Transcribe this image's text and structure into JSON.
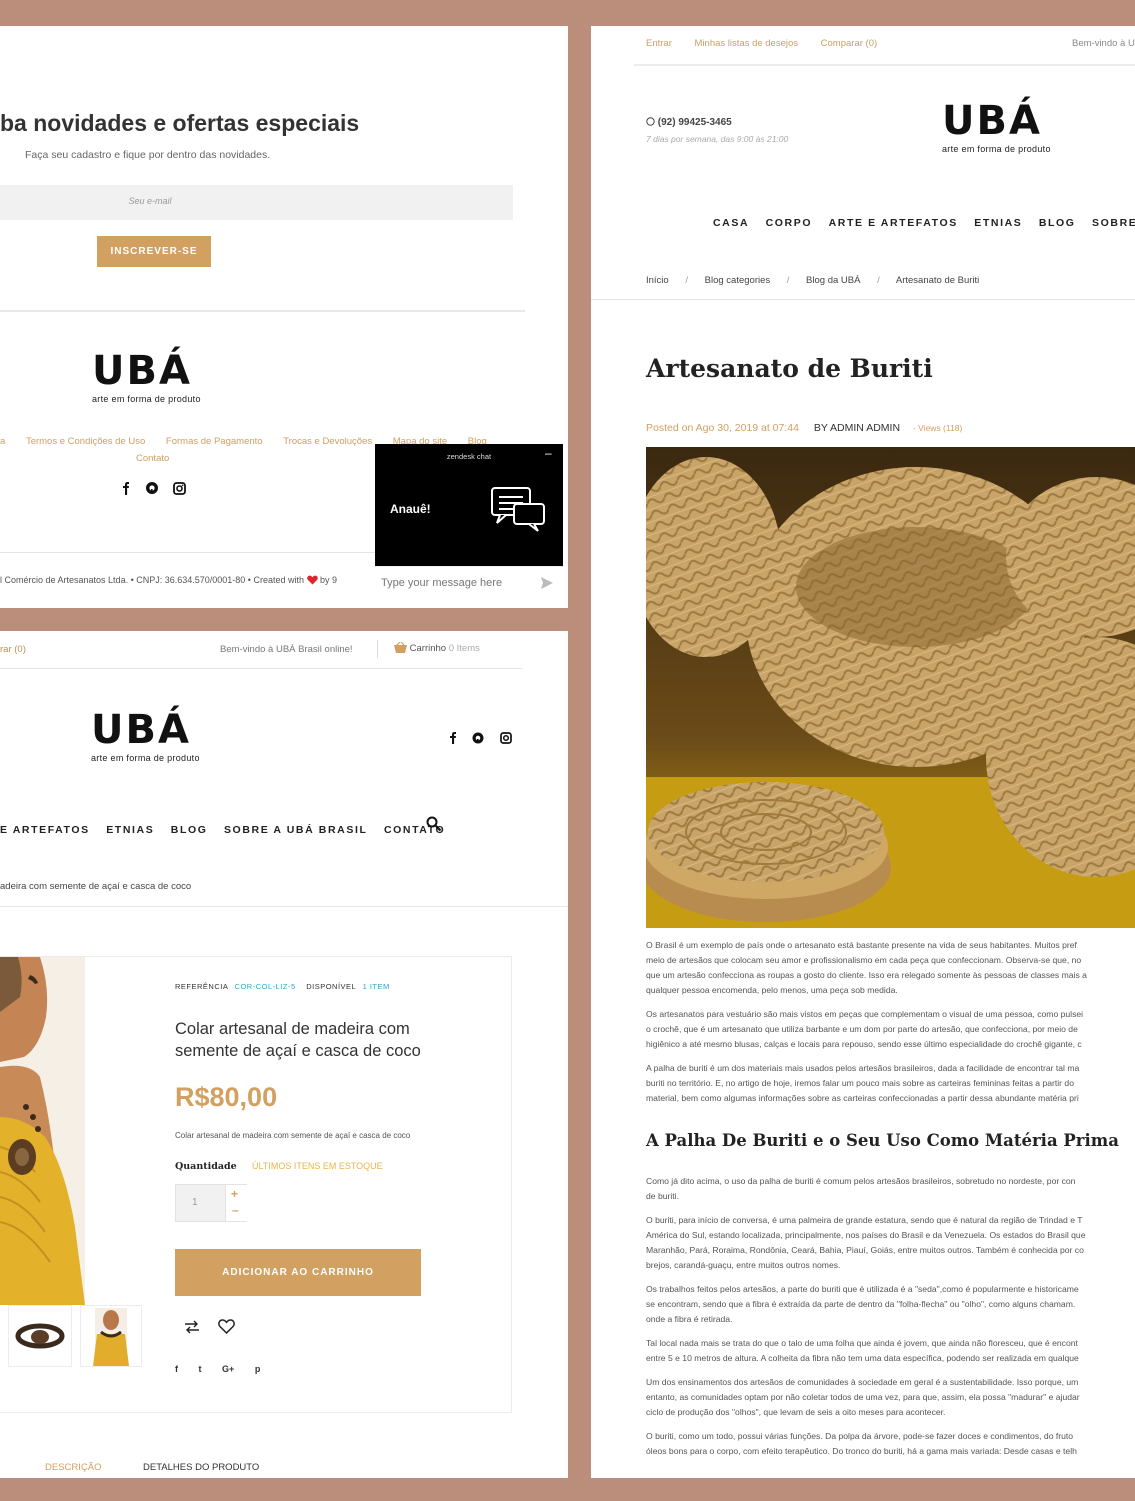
{
  "newsletter": {
    "heading": "ba novidades e ofertas especiais",
    "subheading": "Faça seu cadastro e fique por dentro das novidades.",
    "email_placeholder": "Seu e-mail",
    "subscribe_label": "INSCREVER-SE"
  },
  "brand": {
    "logo_text": "UBÁ",
    "tagline": "arte em forma de produto"
  },
  "footer": {
    "links": [
      "a",
      "Termos e Condições de Uso",
      "Formas de Pagamento",
      "Trocas e Devoluções",
      "Mapa do site",
      "Blog"
    ],
    "contact": "Contato",
    "copyright": "l Comércio de Artesanatos Ltda. • CNPJ: 36.634.570/0001-80 • Created with",
    "copyright_end": "by 9"
  },
  "zendesk": {
    "title": "zendesk chat",
    "minimize": "–",
    "greeting": "Anauê!",
    "input_placeholder": "Type your message here"
  },
  "product_page": {
    "topbar": {
      "compare": "rar (0)",
      "welcome": "Bem-vindo à UBÁ Brasil online!",
      "cart_label": "Carrinho",
      "cart_count": "0 Items"
    },
    "nav": [
      "E ARTEFATOS",
      "ETNIAS",
      "BLOG",
      "SOBRE A UBÁ BRASIL",
      "CONTATO"
    ],
    "breadcrumb_tail": "adeira com semente de açaí e casca de coco",
    "reference_label": "REFERÊNCIA",
    "reference_value": "COR-COL-LIZ-5",
    "available_label": "DISPONÍVEL",
    "available_value": "1 ITEM",
    "title_line1": "Colar artesanal de madeira com",
    "title_line2": "semente de açaí e casca de coco",
    "price": "R$80,00",
    "short_desc": "Colar artesanal de madeira com semente de açaí e casca de coco",
    "quantity_label": "Quantidade",
    "stock_note": "ÚLTIMOS ITENS EM ESTOQUE",
    "quantity_value": "1",
    "plus": "+",
    "minus": "–",
    "add_to_cart": "ADICIONAR AO CARRINHO",
    "social_share": [
      "f",
      "t",
      "G+",
      "p"
    ],
    "tabs": [
      "DESCRIÇÃO",
      "DETALHES DO PRODUTO"
    ]
  },
  "blog_page": {
    "topbar": {
      "login": "Entrar",
      "wishlist": "Minhas listas de desejos",
      "compare": "Comparar (0)",
      "welcome": "Bem-vindo à U"
    },
    "phone": "(92) 99425-3465",
    "hours": "7 dias por semana, das 9:00 às 21:00",
    "nav": [
      "CASA",
      "CORPO",
      "ARTE E ARTEFATOS",
      "ETNIAS",
      "BLOG",
      "SOBRE A UBÁ B"
    ],
    "breadcrumb": [
      "Início",
      "Blog categories",
      "Blog da UBÁ",
      "Artesanato de Buriti"
    ],
    "breadcrumb_sep": "/",
    "title": "Artesanato de Buriti",
    "posted": "Posted on Ago 30, 2019 at 07:44",
    "author": "BY ADMIN ADMIN",
    "views": "- Views (118)",
    "paragraphs1": [
      [
        "O Brasil é um exemplo de país onde o artesanato está bastante presente na vida de seus habitantes. Muitos pref",
        "meio de artesãos que colocam seu amor e profissionalismo em cada peça que confeccionam. Observa-se que, no",
        "que um artesão confecciona as roupas a gosto do cliente. Isso era relegado somente às pessoas de classes mais a",
        "qualquer pessoa encomenda, pelo menos, uma peça sob medida."
      ],
      [
        "Os artesanatos para vestuário são mais vistos em peças que complementam o visual de uma pessoa, como pulsei",
        "o crochê, que é um artesanato que utiliza barbante e um dom por parte do artesão, que confecciona, por meio de",
        "higiênico a até mesmo blusas, calças e  locais para repouso, sendo esse último especialidade do crochê gigante, c"
      ],
      [
        "A palha de buriti é um dos materiais mais usados pelos artesãos brasileiros, dada a facilidade de encontrar tal ma",
        "buriti no território. E, no artigo de hoje, iremos falar um pouco mais sobre as carteiras femininas feitas a partir do",
        "material, bem como algumas informações sobre as carteiras confeccionadas a partir dessa abundante matéria pri"
      ]
    ],
    "subheading": "A Palha De Buriti e o Seu Uso Como Matéria Prima",
    "paragraphs2": [
      [
        "Como já dito acima, o uso da palha de buriti é comum pelos artesãos brasileiros, sobretudo no nordeste, por con",
        "de buriti."
      ],
      [
        "O buriti, para início de conversa, é uma palmeira de grande estatura, sendo que é natural da região de Trindad e T",
        "América do Sul, estando localizada, principalmente, nos países do Brasil e da Venezuela. Os estados do Brasil que",
        "Maranhão, Pará, Roraima, Rondônia, Ceará, Bahia, Piauí, Goiás, entre muitos outros. Também é conhecida por co",
        "brejos, carandá-guaçu, entre muitos outros nomes."
      ],
      [
        "Os trabalhos feitos pelos artesãos, a parte do buriti que é utilizada é a \"seda\",como é popularmente e historicame",
        "se encontram, sendo que a fibra é extraída da parte de dentro da \"folha-flecha\" ou \"olho\", como alguns chamam.",
        "onde a fibra é retirada."
      ],
      [
        "Tal local nada mais se trata do que o talo de uma folha que ainda é jovem, que ainda não floresceu, que é encont",
        "entre 5 e 10 metros de altura. A colheita da fibra não tem uma data específica, podendo ser realizada em qualque"
      ],
      [
        "Um dos ensinamentos dos artesãos de comunidades à sociedade em geral é a sustentabilidade. Isso porque, um",
        "entanto, as comunidades optam por não coletar todos de uma vez, para que, assim, ela possa \"madurar\" e ajudar",
        "ciclo de produção dos \"olhos\", que levam de seis a oito meses para acontecer."
      ],
      [
        "O buriti, como um todo, possui várias funções. Da polpa da árvore, pode-se fazer doces e condimentos, do fruto",
        "óleos bons para o corpo, com efeito terapêutico. Do tronco do buriti, há a gama mais variada: Desde casas e telh"
      ]
    ]
  },
  "colors": {
    "frame": "#bb8e7b",
    "accent_gold": "#d2a061",
    "link_blue": "#2aa7c9",
    "heart_red": "#e0262d",
    "chat_bg": "#000000"
  }
}
